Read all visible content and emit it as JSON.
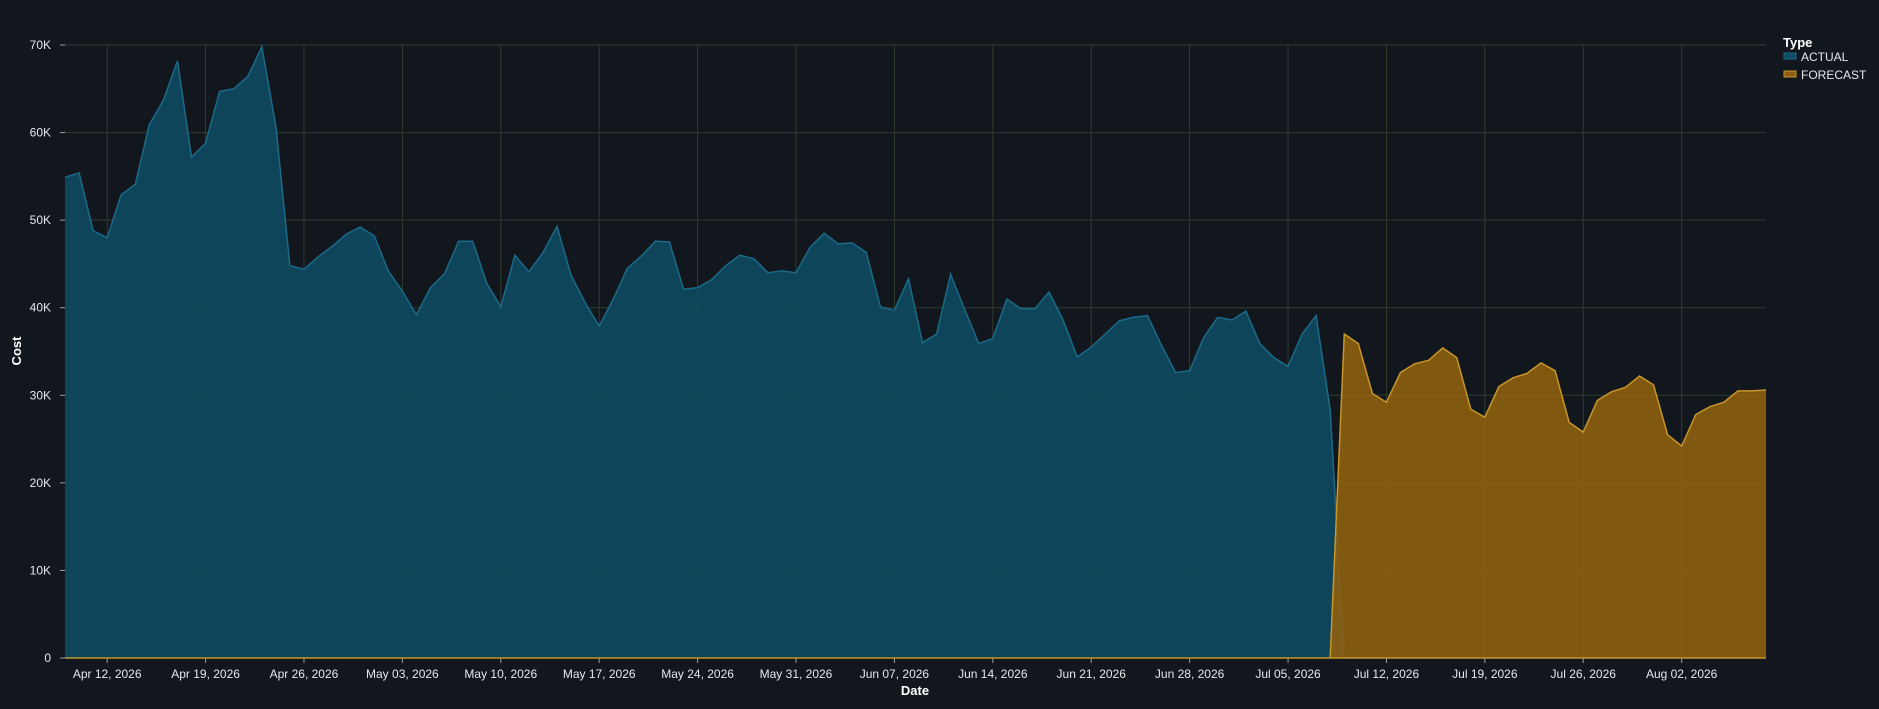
{
  "chart_data": {
    "type": "area",
    "title": "",
    "xlabel": "Date",
    "ylabel": "Cost",
    "ylim": [
      0,
      70000
    ],
    "yticks": [
      0,
      10000,
      20000,
      30000,
      40000,
      50000,
      60000,
      70000
    ],
    "ytick_labels": [
      "0",
      "10K",
      "20K",
      "30K",
      "40K",
      "50K",
      "60K",
      "70K"
    ],
    "xlim": [
      "2026-04-09",
      "2026-08-08"
    ],
    "xtick_dates": [
      "2026-04-12",
      "2026-04-19",
      "2026-04-26",
      "2026-05-03",
      "2026-05-10",
      "2026-05-17",
      "2026-05-24",
      "2026-05-31",
      "2026-06-07",
      "2026-06-14",
      "2026-06-21",
      "2026-06-28",
      "2026-07-05",
      "2026-07-12",
      "2026-07-19",
      "2026-07-26",
      "2026-08-02"
    ],
    "xtick_labels": [
      "Apr 12, 2026",
      "Apr 19, 2026",
      "Apr 26, 2026",
      "May 03, 2026",
      "May 10, 2026",
      "May 17, 2026",
      "May 24, 2026",
      "May 31, 2026",
      "Jun 07, 2026",
      "Jun 14, 2026",
      "Jun 21, 2026",
      "Jun 28, 2026",
      "Jul 05, 2026",
      "Jul 12, 2026",
      "Jul 19, 2026",
      "Jul 26, 2026",
      "Aug 02, 2026"
    ],
    "grid": true,
    "legend": {
      "title": "Type",
      "placement": "top-right"
    },
    "colors": {
      "ACTUAL": "#0f4a62",
      "FORECAST": "#8e5f10"
    },
    "line_colors": {
      "ACTUAL": "#1a6a88",
      "FORECAST": "#c7962a"
    },
    "series": [
      {
        "name": "ACTUAL",
        "x": [
          "2026-04-09",
          "2026-04-10",
          "2026-04-11",
          "2026-04-12",
          "2026-04-13",
          "2026-04-14",
          "2026-04-15",
          "2026-04-16",
          "2026-04-17",
          "2026-04-18",
          "2026-04-19",
          "2026-04-20",
          "2026-04-21",
          "2026-04-22",
          "2026-04-23",
          "2026-04-24",
          "2026-04-25",
          "2026-04-26",
          "2026-04-27",
          "2026-04-28",
          "2026-04-29",
          "2026-04-30",
          "2026-05-01",
          "2026-05-02",
          "2026-05-03",
          "2026-05-04",
          "2026-05-05",
          "2026-05-06",
          "2026-05-07",
          "2026-05-08",
          "2026-05-09",
          "2026-05-10",
          "2026-05-11",
          "2026-05-12",
          "2026-05-13",
          "2026-05-14",
          "2026-05-15",
          "2026-05-16",
          "2026-05-17",
          "2026-05-18",
          "2026-05-19",
          "2026-05-20",
          "2026-05-21",
          "2026-05-22",
          "2026-05-23",
          "2026-05-24",
          "2026-05-25",
          "2026-05-26",
          "2026-05-27",
          "2026-05-28",
          "2026-05-29",
          "2026-05-30",
          "2026-05-31",
          "2026-06-01",
          "2026-06-02",
          "2026-06-03",
          "2026-06-04",
          "2026-06-05",
          "2026-06-06",
          "2026-06-07",
          "2026-06-08",
          "2026-06-09",
          "2026-06-10",
          "2026-06-11",
          "2026-06-12",
          "2026-06-13",
          "2026-06-14",
          "2026-06-15",
          "2026-06-16",
          "2026-06-17",
          "2026-06-18",
          "2026-06-19",
          "2026-06-20",
          "2026-06-21",
          "2026-06-22",
          "2026-06-23",
          "2026-06-24",
          "2026-06-25",
          "2026-06-26",
          "2026-06-27",
          "2026-06-28",
          "2026-06-29",
          "2026-06-30",
          "2026-07-01",
          "2026-07-02",
          "2026-07-03",
          "2026-07-04",
          "2026-07-05",
          "2026-07-06",
          "2026-07-07",
          "2026-07-08",
          "2026-07-09"
        ],
        "values": [
          54900,
          55400,
          48800,
          48000,
          52900,
          54100,
          60900,
          63700,
          68200,
          57200,
          58800,
          64700,
          65000,
          66400,
          69800,
          60700,
          44800,
          44400,
          45800,
          47000,
          48400,
          49200,
          48200,
          44200,
          41900,
          39200,
          42300,
          43900,
          47600,
          47600,
          42800,
          40100,
          46000,
          44100,
          46300,
          49300,
          43700,
          40600,
          37900,
          41000,
          44500,
          45900,
          47600,
          47500,
          42100,
          42300,
          43200,
          44800,
          46000,
          45600,
          44000,
          44200,
          44000,
          46900,
          48500,
          47300,
          47400,
          46300,
          40100,
          39700,
          43300,
          36000,
          37000,
          43800,
          39800,
          35900,
          36500,
          41000,
          39900,
          39900,
          41800,
          38600,
          34400,
          35500,
          37000,
          38500,
          38900,
          39100,
          35700,
          32600,
          32800,
          36600,
          38900,
          38600,
          39600,
          35900,
          34300,
          33300,
          37000,
          39100,
          28300,
          0
        ]
      },
      {
        "name": "FORECAST",
        "x": [
          "2026-07-08",
          "2026-07-09",
          "2026-07-10",
          "2026-07-11",
          "2026-07-12",
          "2026-07-13",
          "2026-07-14",
          "2026-07-15",
          "2026-07-16",
          "2026-07-17",
          "2026-07-18",
          "2026-07-19",
          "2026-07-20",
          "2026-07-21",
          "2026-07-22",
          "2026-07-23",
          "2026-07-24",
          "2026-07-25",
          "2026-07-26",
          "2026-07-27",
          "2026-07-28",
          "2026-07-29",
          "2026-07-30",
          "2026-07-31",
          "2026-08-01",
          "2026-08-02",
          "2026-08-03",
          "2026-08-04",
          "2026-08-05",
          "2026-08-06",
          "2026-08-07",
          "2026-08-08"
        ],
        "values": [
          0,
          37000,
          35900,
          30200,
          29200,
          32600,
          33600,
          34000,
          35400,
          34300,
          28400,
          27500,
          31000,
          32000,
          32500,
          33700,
          32800,
          26900,
          25800,
          29400,
          30400,
          30900,
          32200,
          31200,
          25500,
          24200,
          27800,
          28700,
          29200,
          30500,
          30500,
          30600
        ]
      }
    ]
  }
}
